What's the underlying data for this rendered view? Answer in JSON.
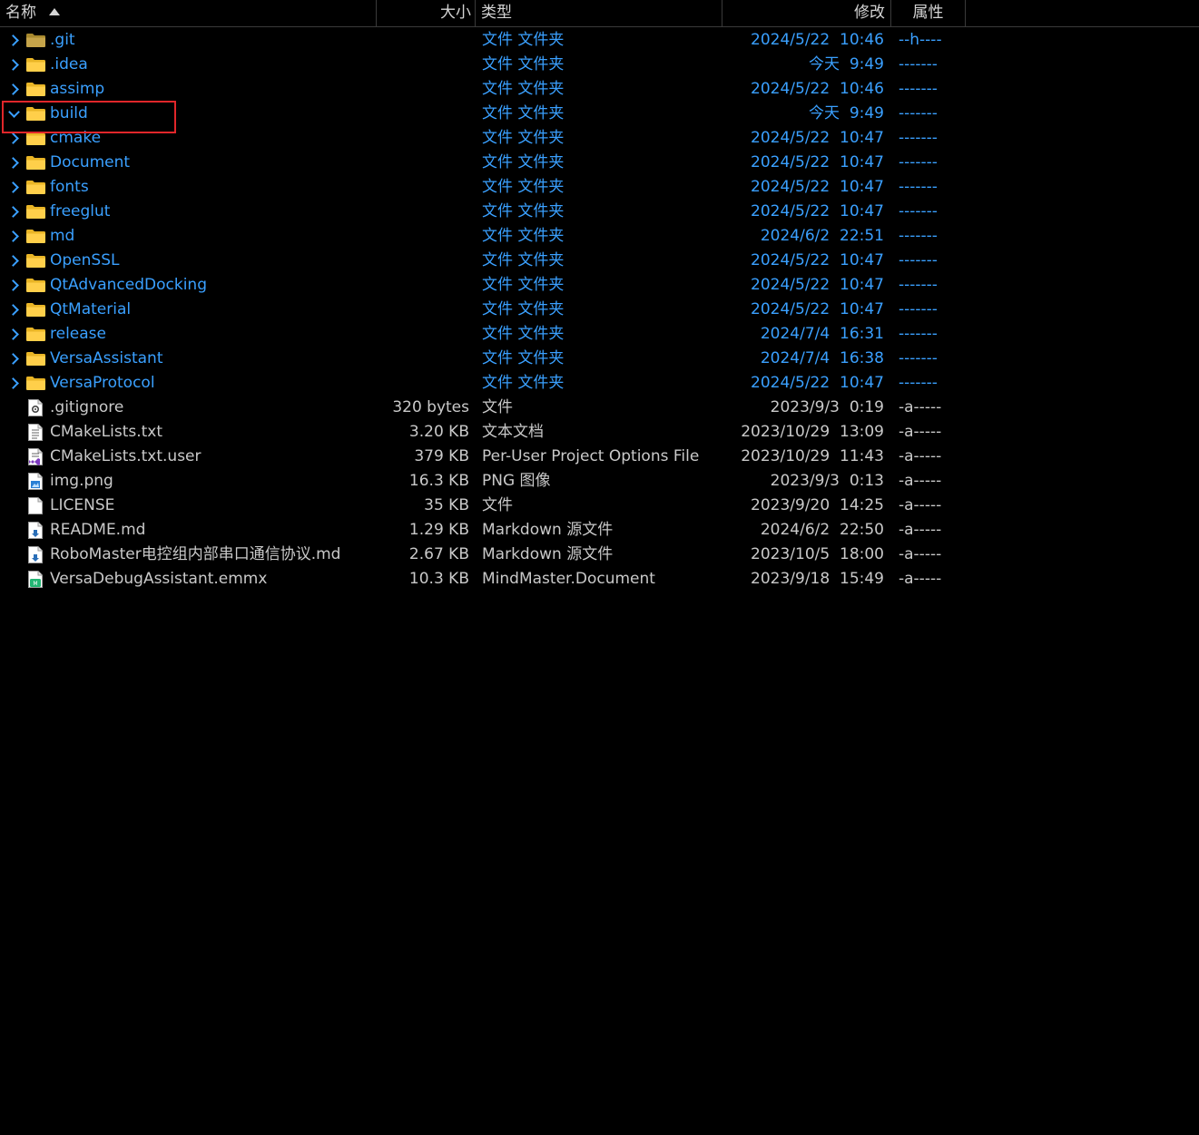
{
  "columns": {
    "name": "名称",
    "size": "大小",
    "type": "类型",
    "modified": "修改",
    "attributes": "属性"
  },
  "colors": {
    "folder_text": "#3aa0ff",
    "file_text": "#c9c9c9",
    "background": "#000000",
    "highlight": "#e0262a"
  },
  "items": [
    {
      "name": ".git",
      "kind": "folder",
      "expanded": false,
      "size": "",
      "type": "文件 文件夹",
      "date": "2024/5/22",
      "time": "10:46",
      "attr": "--h----",
      "icon": "folder-hidden-icon"
    },
    {
      "name": ".idea",
      "kind": "folder",
      "expanded": false,
      "size": "",
      "type": "文件 文件夹",
      "date": "今天",
      "time": "9:49",
      "attr": "-------",
      "icon": "folder-icon"
    },
    {
      "name": "assimp",
      "kind": "folder",
      "expanded": false,
      "size": "",
      "type": "文件 文件夹",
      "date": "2024/5/22",
      "time": "10:46",
      "attr": "-------",
      "icon": "folder-icon"
    },
    {
      "name": "build",
      "kind": "folder",
      "expanded": true,
      "size": "",
      "type": "文件 文件夹",
      "date": "今天",
      "time": "9:49",
      "attr": "-------",
      "icon": "folder-icon"
    },
    {
      "name": "cmake",
      "kind": "folder",
      "expanded": false,
      "size": "",
      "type": "文件 文件夹",
      "date": "2024/5/22",
      "time": "10:47",
      "attr": "-------",
      "icon": "folder-icon"
    },
    {
      "name": "Document",
      "kind": "folder",
      "expanded": false,
      "size": "",
      "type": "文件 文件夹",
      "date": "2024/5/22",
      "time": "10:47",
      "attr": "-------",
      "icon": "folder-icon"
    },
    {
      "name": "fonts",
      "kind": "folder",
      "expanded": false,
      "size": "",
      "type": "文件 文件夹",
      "date": "2024/5/22",
      "time": "10:47",
      "attr": "-------",
      "icon": "folder-icon"
    },
    {
      "name": "freeglut",
      "kind": "folder",
      "expanded": false,
      "size": "",
      "type": "文件 文件夹",
      "date": "2024/5/22",
      "time": "10:47",
      "attr": "-------",
      "icon": "folder-icon"
    },
    {
      "name": "md",
      "kind": "folder",
      "expanded": false,
      "size": "",
      "type": "文件 文件夹",
      "date": "2024/6/2",
      "time": "22:51",
      "attr": "-------",
      "icon": "folder-icon"
    },
    {
      "name": "OpenSSL",
      "kind": "folder",
      "expanded": false,
      "size": "",
      "type": "文件 文件夹",
      "date": "2024/5/22",
      "time": "10:47",
      "attr": "-------",
      "icon": "folder-icon"
    },
    {
      "name": "QtAdvancedDocking",
      "kind": "folder",
      "expanded": false,
      "size": "",
      "type": "文件 文件夹",
      "date": "2024/5/22",
      "time": "10:47",
      "attr": "-------",
      "icon": "folder-icon"
    },
    {
      "name": "QtMaterial",
      "kind": "folder",
      "expanded": false,
      "size": "",
      "type": "文件 文件夹",
      "date": "2024/5/22",
      "time": "10:47",
      "attr": "-------",
      "icon": "folder-icon"
    },
    {
      "name": "release",
      "kind": "folder",
      "expanded": false,
      "size": "",
      "type": "文件 文件夹",
      "date": "2024/7/4",
      "time": "16:31",
      "attr": "-------",
      "icon": "folder-icon"
    },
    {
      "name": "VersaAssistant",
      "kind": "folder",
      "expanded": false,
      "size": "",
      "type": "文件 文件夹",
      "date": "2024/7/4",
      "time": "16:38",
      "attr": "-------",
      "icon": "folder-icon"
    },
    {
      "name": "VersaProtocol",
      "kind": "folder",
      "expanded": false,
      "size": "",
      "type": "文件 文件夹",
      "date": "2024/5/22",
      "time": "10:47",
      "attr": "-------",
      "icon": "folder-icon"
    },
    {
      "name": ".gitignore",
      "kind": "file",
      "size": "320 bytes",
      "type": "文件",
      "date": "2023/9/3",
      "time": "0:19",
      "attr": "-a-----",
      "icon": "settings-file-icon"
    },
    {
      "name": "CMakeLists.txt",
      "kind": "file",
      "size": "3.20 KB",
      "type": "文本文档",
      "date": "2023/10/29",
      "time": "13:09",
      "attr": "-a-----",
      "icon": "text-file-icon"
    },
    {
      "name": "CMakeLists.txt.user",
      "kind": "file",
      "size": "379 KB",
      "type": "Per-User Project Options File",
      "date": "2023/10/29",
      "time": "11:43",
      "attr": "-a-----",
      "icon": "visual-studio-file-icon"
    },
    {
      "name": "img.png",
      "kind": "file",
      "size": "16.3 KB",
      "type": "PNG 图像",
      "date": "2023/9/3",
      "time": "0:13",
      "attr": "-a-----",
      "icon": "image-file-icon"
    },
    {
      "name": "LICENSE",
      "kind": "file",
      "size": "35 KB",
      "type": "文件",
      "date": "2023/9/20",
      "time": "14:25",
      "attr": "-a-----",
      "icon": "blank-file-icon"
    },
    {
      "name": "README.md",
      "kind": "file",
      "size": "1.29 KB",
      "type": "Markdown 源文件",
      "date": "2024/6/2",
      "time": "22:50",
      "attr": "-a-----",
      "icon": "markdown-file-icon"
    },
    {
      "name": "RoboMaster电控组内部串口通信协议.md",
      "kind": "file",
      "size": "2.67 KB",
      "type": "Markdown 源文件",
      "date": "2023/10/5",
      "time": "18:00",
      "attr": "-a-----",
      "icon": "markdown-file-icon"
    },
    {
      "name": "VersaDebugAssistant.emmx",
      "kind": "file",
      "size": "10.3 KB",
      "type": "MindMaster.Document",
      "date": "2023/9/18",
      "time": "15:49",
      "attr": "-a-----",
      "icon": "mindmaster-file-icon"
    }
  ]
}
